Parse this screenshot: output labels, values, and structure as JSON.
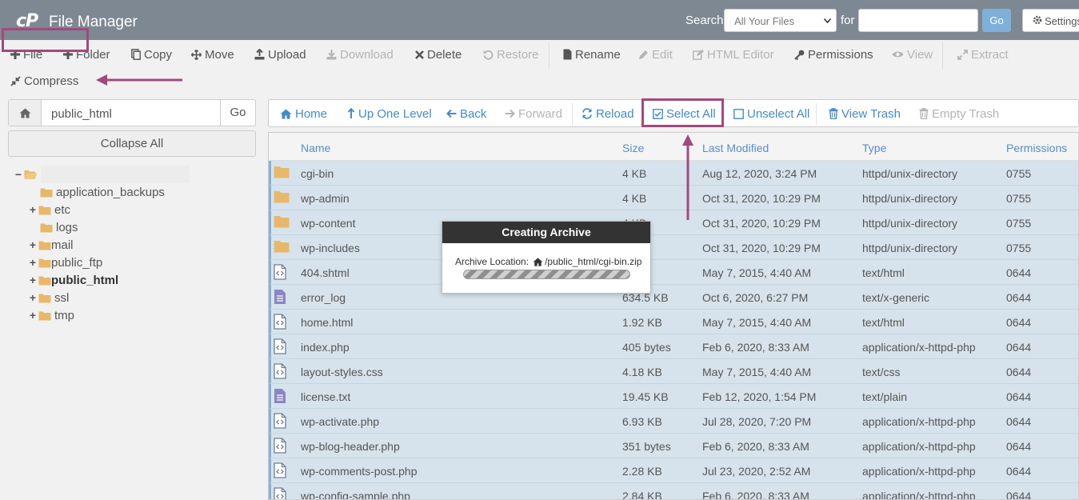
{
  "header": {
    "logo": "cP",
    "title": "File Manager",
    "search_label": "Search",
    "search_scope": "All Your Files",
    "for_label": "for",
    "search_value": "",
    "go_label": "Go",
    "settings_label": "Settings"
  },
  "toolbar": {
    "file": "File",
    "folder": "Folder",
    "copy": "Copy",
    "move": "Move",
    "upload": "Upload",
    "download": "Download",
    "delete": "Delete",
    "restore": "Restore",
    "rename": "Rename",
    "edit": "Edit",
    "html_editor": "HTML Editor",
    "permissions": "Permissions",
    "view": "View",
    "extract": "Extract",
    "compress": "Compress"
  },
  "sidebar": {
    "path_value": "public_html",
    "go_label": "Go",
    "collapse_label": "Collapse All",
    "tree": [
      {
        "label": "application_backups",
        "expander": ""
      },
      {
        "label": "etc",
        "expander": "+"
      },
      {
        "label": "logs",
        "expander": ""
      },
      {
        "label": "mail",
        "expander": "+"
      },
      {
        "label": "public_ftp",
        "expander": "+"
      },
      {
        "label": "public_html",
        "expander": "+"
      },
      {
        "label": "ssl",
        "expander": "+"
      },
      {
        "label": "tmp",
        "expander": "+"
      }
    ],
    "root_expander": "−"
  },
  "navbar": {
    "home": "Home",
    "up_one_level": "Up One Level",
    "back": "Back",
    "forward": "Forward",
    "reload": "Reload",
    "select_all": "Select All",
    "unselect_all": "Unselect All",
    "view_trash": "View Trash",
    "empty_trash": "Empty Trash"
  },
  "table": {
    "headers": {
      "name": "Name",
      "size": "Size",
      "modified": "Last Modified",
      "type": "Type",
      "perms": "Permissions"
    },
    "rows": [
      {
        "icon": "folder",
        "name": "cgi-bin",
        "size": "4 KB",
        "modified": "Aug 12, 2020, 3:24 PM",
        "type": "httpd/unix-directory",
        "perms": "0755"
      },
      {
        "icon": "folder",
        "name": "wp-admin",
        "size": "4 KB",
        "modified": "Oct 31, 2020, 10:29 PM",
        "type": "httpd/unix-directory",
        "perms": "0755"
      },
      {
        "icon": "folder",
        "name": "wp-content",
        "size": "4 KB",
        "modified": "Oct 31, 2020, 10:29 PM",
        "type": "httpd/unix-directory",
        "perms": "0755"
      },
      {
        "icon": "folder",
        "name": "wp-includes",
        "size": "",
        "modified": "Oct 31, 2020, 10:29 PM",
        "type": "httpd/unix-directory",
        "perms": "0755"
      },
      {
        "icon": "code",
        "name": "404.shtml",
        "size": "KB",
        "modified": "May 7, 2015, 4:40 AM",
        "type": "text/html",
        "perms": "0644"
      },
      {
        "icon": "text",
        "name": "error_log",
        "size": "634.5 KB",
        "modified": "Oct 6, 2020, 6:27 PM",
        "type": "text/x-generic",
        "perms": "0644"
      },
      {
        "icon": "code",
        "name": "home.html",
        "size": "1.92 KB",
        "modified": "May 7, 2015, 4:40 AM",
        "type": "text/html",
        "perms": "0644"
      },
      {
        "icon": "code",
        "name": "index.php",
        "size": "405 bytes",
        "modified": "Feb 6, 2020, 8:33 AM",
        "type": "application/x-httpd-php",
        "perms": "0644"
      },
      {
        "icon": "code",
        "name": "layout-styles.css",
        "size": "4.18 KB",
        "modified": "May 7, 2015, 4:40 AM",
        "type": "text/css",
        "perms": "0644"
      },
      {
        "icon": "text",
        "name": "license.txt",
        "size": "19.45 KB",
        "modified": "Feb 12, 2020, 1:54 PM",
        "type": "text/plain",
        "perms": "0644"
      },
      {
        "icon": "code",
        "name": "wp-activate.php",
        "size": "6.93 KB",
        "modified": "Jul 28, 2020, 7:20 PM",
        "type": "application/x-httpd-php",
        "perms": "0644"
      },
      {
        "icon": "code",
        "name": "wp-blog-header.php",
        "size": "351 bytes",
        "modified": "Feb 6, 2020, 8:33 AM",
        "type": "application/x-httpd-php",
        "perms": "0644"
      },
      {
        "icon": "code",
        "name": "wp-comments-post.php",
        "size": "2.28 KB",
        "modified": "Jul 23, 2020, 2:52 AM",
        "type": "application/x-httpd-php",
        "perms": "0644"
      },
      {
        "icon": "code",
        "name": "wp-config-sample.php",
        "size": "2.84 KB",
        "modified": "Feb 6, 2020, 8:33 AM",
        "type": "application/x-httpd-php",
        "perms": "0644"
      }
    ]
  },
  "modal": {
    "title": "Creating Archive",
    "location_label": "Archive Location:",
    "location_path": "/public_html/cgi-bin.zip"
  },
  "colors": {
    "header_bg": "#7e8893",
    "link": "#428bca",
    "annotation": "#a2497d",
    "selected_row": "#d6e3ec",
    "folder": "#e8b86a"
  }
}
